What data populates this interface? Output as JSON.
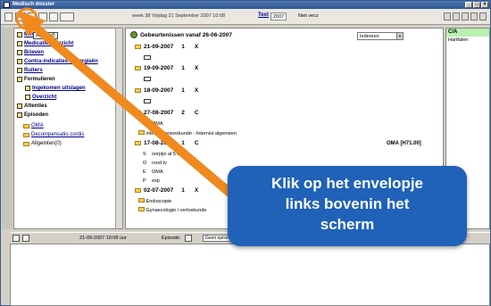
{
  "window": {
    "title": "Medisch dossier"
  },
  "toolbar": {
    "week_info": "week 38 Vrijdag 21 September 2007 10:08",
    "tekst_label": "Text",
    "year_value": "2007",
    "niet_vecz": "Niet vecz"
  },
  "left_nav": {
    "popup": "Alg (Ref)",
    "items": [
      {
        "label": "Memo"
      },
      {
        "label": "Medicatie overzicht"
      },
      {
        "label": "Brieven"
      },
      {
        "label": "Contra-indicaties / Allergieën"
      },
      {
        "label": "Ruiters"
      },
      {
        "label": "Formulieren"
      },
      {
        "label": "Ingekomen uitslagen"
      },
      {
        "label": "Overzicht"
      },
      {
        "label": "Attenties"
      },
      {
        "label": "Episoden"
      },
      {
        "label": "OMA"
      },
      {
        "label": "Decompensatio cordis"
      },
      {
        "label": "Allgeloten(0)"
      }
    ]
  },
  "journal": {
    "heading": "Gebeurtenissen vanaf 26-06-2007",
    "filter_value": "Iedereen",
    "entries": [
      {
        "date": "21-09-2007",
        "count": "1",
        "code": "X"
      },
      {
        "date": "19-09-2007",
        "count": "1",
        "code": "X"
      },
      {
        "date": "18-09-2007",
        "count": "1",
        "code": "X"
      },
      {
        "date": "27-08-2007",
        "count": "2",
        "code": "C"
      },
      {
        "date": "17-08-2007",
        "count": "1",
        "code": "C"
      },
      {
        "date": "02-07-2007",
        "count": "1",
        "code": "X"
      }
    ],
    "details": {
      "e1_k": "E",
      "e1_v": "OMA",
      "e2_v": "interne geneeskunde - Internist algemeen",
      "oma_right": "OMA [H71.00]",
      "s_k": "S",
      "s_v": "oorpijn al 5 dgn",
      "o_k": "O",
      "o_v": "rood tv",
      "e3_k": "E",
      "e3_v": "OMA",
      "p_k": "P",
      "p_v": "exp",
      "x1_v": "Endoscopie",
      "x2_v": "Gynaecologie / verloskunde"
    }
  },
  "right_panel": {
    "header": "C/A",
    "item": "Hartfalen"
  },
  "bottom_bar": {
    "datetime": "21-09-2007   10:08 uur",
    "episode_label": "Episode:",
    "episode_value": "Geen episode"
  },
  "callout": {
    "line1": "Klik op het envelopje",
    "line2": "links bovenin het",
    "line3": "scherm"
  },
  "colors": {
    "callout": "#1f62b8",
    "arrow": "#f08a1e"
  }
}
